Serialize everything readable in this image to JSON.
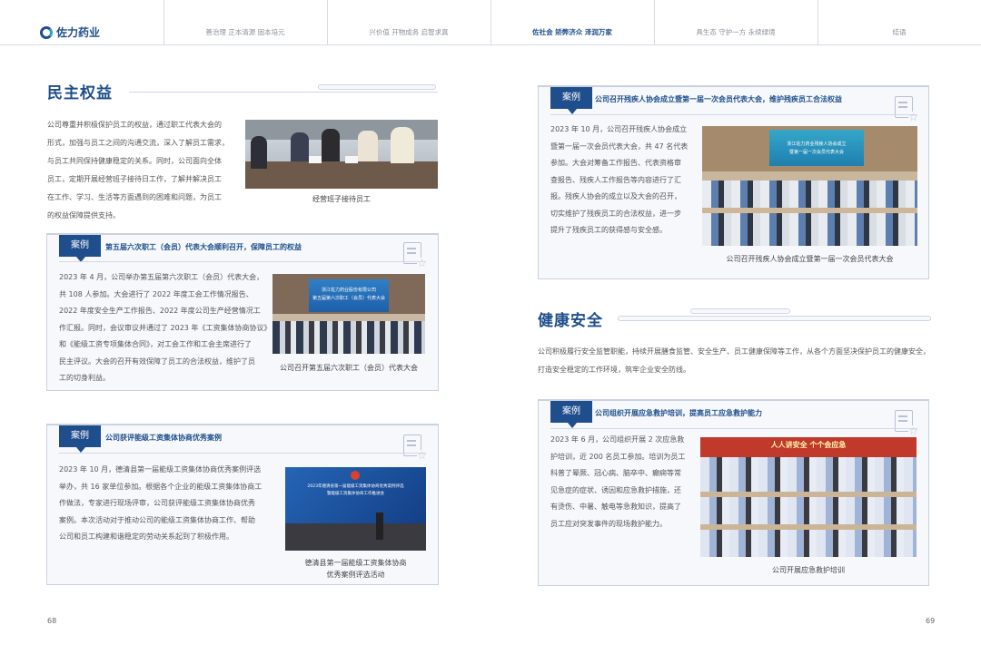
{
  "nav": {
    "logo": "佐力药业",
    "items": [
      {
        "label": "善治理 正本清源 固本培元"
      },
      {
        "label": "兴价值 开物成务 启智求真"
      },
      {
        "label": "佐社会 矫弊济众 泽润万家"
      },
      {
        "label": "具生态 守护一方 永续绿境"
      },
      {
        "label": "结语"
      }
    ]
  },
  "left": {
    "title": "民主权益",
    "intro": [
      "公司尊重并积极保护员工的权益，通过职工代表大会的",
      "形式，加强与员工之间的沟通交流，深入了解员工需求，",
      "与员工共同保持健康稳定的关系。同时，公司面向全体",
      "员工，定期开展经营班子接待日工作，了解并解决员工",
      "在工作、学习、生活等方面遇到的困难和问题，为员工",
      "的权益保障提供支持。"
    ],
    "photo1_caption": "经营班子接待员工",
    "case1": {
      "tag": "案例",
      "title": "第五届六次职工（会员）代表大会顺利召开，保障员工的权益",
      "text": [
        "2023 年 4 月，公司举办第五届第六次职工（会员）代表大会，",
        "共 108 人参加。大会进行了 2022 年度工会工作情况报告、",
        "2022 年度安全生产工作报告、2022 年度公司生产经营情况工",
        "作汇报。同时，会议审议并通过了 2023 年《工资集体协商协议》",
        "和《能级工资专项集体合同》，对工会工作和工会主席进行了",
        "民主评议。大会的召开有效保障了员工的合法权益，维护了员",
        "工的切身利益。"
      ],
      "screen_line1": "浙江佐力药业股份有限公司",
      "screen_line2": "第五届第六次职工（会员）代表大会",
      "caption": "公司召开第五届六次职工（会员）代表大会"
    },
    "case2": {
      "tag": "案例",
      "title": "公司获评能级工资集体协商优秀案例",
      "text": [
        "2023 年 10 月，德清县第一届能级工资集体协商优秀案例评选",
        "举办，共 16 家单位参加。根据各个企业的能级工资集体协商工",
        "作做法，专家进行现场评审，公司获评能级工资集体协商优秀",
        "案例。本次活动对于推动公司的能级工资集体协商工作、帮助",
        "公司和员工构建和谐稳定的劳动关系起到了积极作用。"
      ],
      "screen_line1": "2023年德清县第一届能级工资集体协商优秀案例评选",
      "screen_line2": "暨能级工资集体协商工作推进会",
      "caption_lines": [
        "德清县第一届能级工资集体协商",
        "优秀案例评选活动"
      ]
    },
    "page_number": "68"
  },
  "right": {
    "case3": {
      "tag": "案例",
      "title": "公司召开残疾人协会成立暨第一届一次会员代表大会，维护残疾员工合法权益",
      "text": [
        "2023 年 10 月，公司召开残疾人协会成立",
        "暨第一届一次会员代表大会，共 47 名代表",
        "参加。大会对筹备工作报告、代表资格审",
        "查报告、残疾人工作报告等内容进行了汇",
        "报。残疾人协会的成立以及大会的召开，",
        "切实维护了残疾员工的合法权益，进一步",
        "提升了残疾员工的获得感与安全感。"
      ],
      "screen_line1": "浙江佐力药业残疾人协会成立",
      "screen_line2": "暨第一届一次会员代表大会",
      "caption": "公司召开残疾人协会成立暨第一届一次会员代表大会"
    },
    "title": "健康安全",
    "intro": [
      "公司积极履行安全监管职能，持续开展膳食监管、安全生产、员工健康保障等工作，从各个方面坚决保护员工的健康安全，",
      "打造安全稳定的工作环境，筑牢企业安全防线。"
    ],
    "case4": {
      "tag": "案例",
      "title": "公司组织开展应急救护培训，提高员工应急救护能力",
      "text": [
        "2023 年 6 月，公司组织开展 2 次应急救",
        "护培训，近 200 名员工参加。培训为员工",
        "科普了晕厥、冠心病、脑卒中、癫痫等常",
        "见急症的症状、诱因和应急救护措施，还",
        "有烫伤、中暑、触电等急救知识，提高了",
        "员工应对突发事件的现场救护能力。"
      ],
      "banner": "人人讲安全  个个会应急",
      "caption": "公司开展应急救护培训"
    },
    "page_number": "69"
  }
}
